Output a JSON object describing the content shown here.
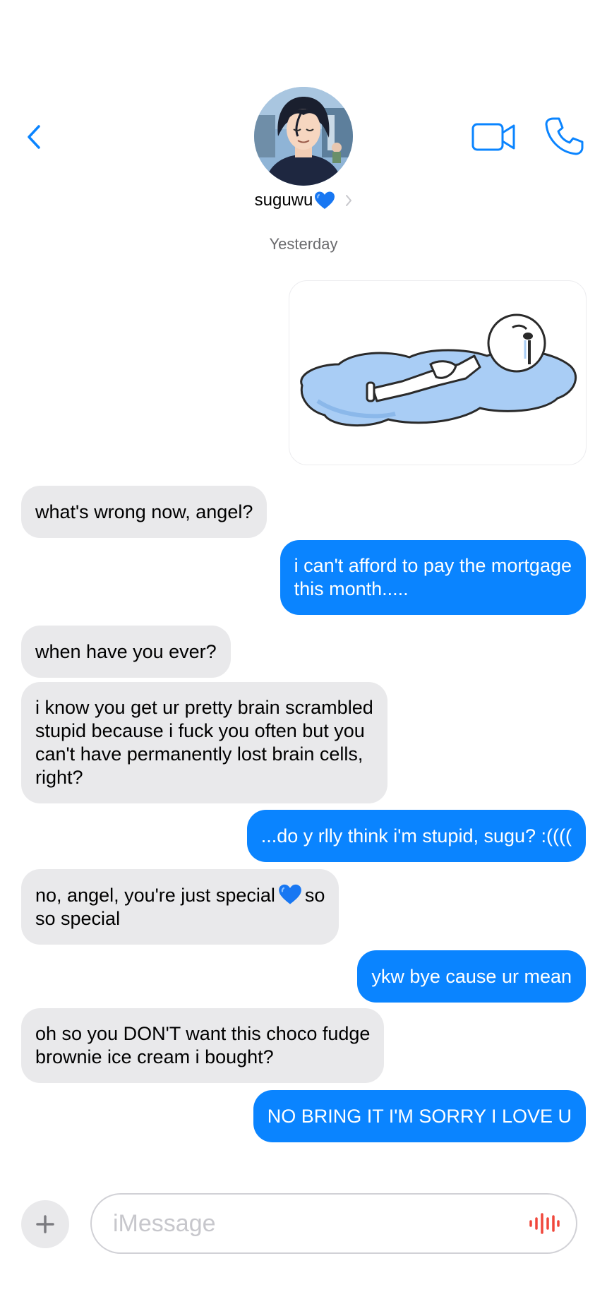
{
  "header": {
    "back_icon": "chevron-left-icon",
    "contact_name": "suguwu",
    "contact_emoji": "blue-heart",
    "video_icon": "video-camera-icon",
    "call_icon": "phone-icon",
    "accent_color": "#0a84ff"
  },
  "conversation": {
    "date_label": "Yesterday",
    "sticker": "crying-figure-lying-in-puddle-sticker",
    "messages": [
      {
        "from": "them",
        "text": "what's wrong now, angel?"
      },
      {
        "from": "me",
        "text": "i can't afford to pay the mortgage\nthis month....."
      },
      {
        "from": "them",
        "text": "when have you ever?"
      },
      {
        "from": "them",
        "text": "i know you get ur pretty brain scrambled\nstupid because i fuck you often but you\ncan't have permanently lost brain cells,\nright?"
      },
      {
        "from": "me",
        "text": "...do y rlly think i'm stupid, sugu? :(((("
      },
      {
        "from": "them",
        "text_before": "no, angel, you're just special",
        "text_after": "so",
        "text_line2": "so special"
      },
      {
        "from": "me",
        "text": "ykw bye cause ur mean"
      },
      {
        "from": "them",
        "text": "oh so you DON'T want this choco fudge\nbrownie ice cream i bought?"
      },
      {
        "from": "me",
        "text": "NO BRING IT I'M SORRY I LOVE U"
      }
    ],
    "incoming_bubble_color": "#e9e9eb",
    "outgoing_bubble_color": "#0a84ff"
  },
  "composer": {
    "plus_icon": "plus-icon",
    "placeholder": "iMessage",
    "value": "",
    "audio_icon": "audio-waveform-icon"
  }
}
